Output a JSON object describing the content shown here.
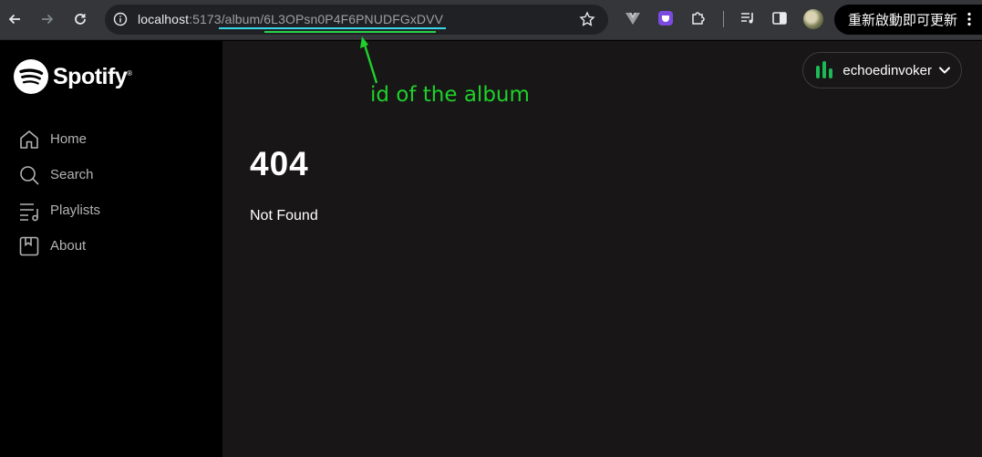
{
  "browser": {
    "url_host": "localhost",
    "url_path": ":5173/album/6L3OPsn0P4F6PNUDFGxDVV",
    "update_button_label": "重新啟動即可更新",
    "icons": [
      "back-arrow-icon",
      "forward-arrow-icon",
      "reload-icon",
      "site-info-icon",
      "bookmark-star-icon",
      "vue-devtools-icon",
      "extension-purple-icon",
      "extensions-puzzle-icon",
      "media-controls-icon",
      "side-panel-icon",
      "profile-avatar",
      "menu-dots-icon"
    ]
  },
  "annotation": {
    "text": "id of the album",
    "color": "#1ed12a"
  },
  "sidebar": {
    "logo_text": "Spotify",
    "logo_mark": "®",
    "items": [
      {
        "label": "Home",
        "icon": "home-icon"
      },
      {
        "label": "Search",
        "icon": "search-icon"
      },
      {
        "label": "Playlists",
        "icon": "playlists-icon"
      },
      {
        "label": "About",
        "icon": "about-icon"
      }
    ]
  },
  "header": {
    "username": "echoedinvoker",
    "user_icon_color": "#1db954"
  },
  "main": {
    "error_code": "404",
    "error_message": "Not Found"
  },
  "colors": {
    "main_bg": "#181616",
    "sidebar_bg": "#000000",
    "nav_text": "#b3b3b3",
    "accent": "#1db954"
  }
}
